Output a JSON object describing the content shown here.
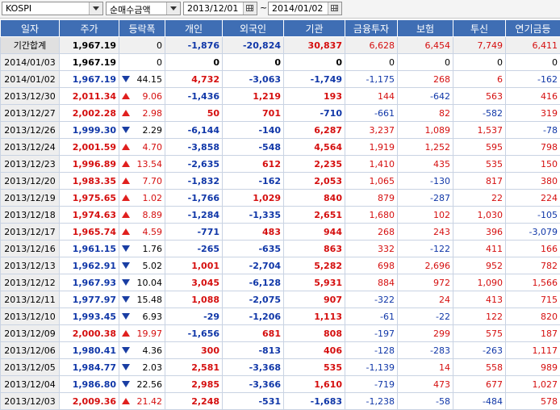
{
  "toolbar": {
    "market": "KOSPI",
    "metric": "순매수금액",
    "date_from": "2013/12/01",
    "date_to": "2014/01/02",
    "separator": "~"
  },
  "columns": [
    "일자",
    "주가",
    "등락폭",
    "개인",
    "외국인",
    "기관",
    "금융투자",
    "보험",
    "투신",
    "연기금등"
  ],
  "rows": [
    {
      "date": "기간합계",
      "close": "1,967.19",
      "dir": "none",
      "chg": "0",
      "indiv": "-1,876",
      "foreign": "-20,824",
      "inst": "30,837",
      "fin": "6,628",
      "ins": "6,454",
      "trust": "7,749",
      "pension": "6,411"
    },
    {
      "date": "2014/01/03",
      "close": "1,967.19",
      "dir": "none",
      "chg": "0",
      "indiv": "0",
      "foreign": "0",
      "inst": "0",
      "fin": "0",
      "ins": "0",
      "trust": "0",
      "pension": "0"
    },
    {
      "date": "2014/01/02",
      "close": "1,967.19",
      "dir": "down",
      "chg": "44.15",
      "indiv": "4,732",
      "foreign": "-3,063",
      "inst": "-1,749",
      "fin": "-1,175",
      "ins": "268",
      "trust": "6",
      "pension": "-162"
    },
    {
      "date": "2013/12/30",
      "close": "2,011.34",
      "dir": "up",
      "chg": "9.06",
      "indiv": "-1,436",
      "foreign": "1,219",
      "inst": "193",
      "fin": "144",
      "ins": "-642",
      "trust": "563",
      "pension": "416"
    },
    {
      "date": "2013/12/27",
      "close": "2,002.28",
      "dir": "up",
      "chg": "2.98",
      "indiv": "50",
      "foreign": "701",
      "inst": "-710",
      "fin": "-661",
      "ins": "82",
      "trust": "-582",
      "pension": "319"
    },
    {
      "date": "2013/12/26",
      "close": "1,999.30",
      "dir": "down",
      "chg": "2.29",
      "indiv": "-6,144",
      "foreign": "-140",
      "inst": "6,287",
      "fin": "3,237",
      "ins": "1,089",
      "trust": "1,537",
      "pension": "-78"
    },
    {
      "date": "2013/12/24",
      "close": "2,001.59",
      "dir": "up",
      "chg": "4.70",
      "indiv": "-3,858",
      "foreign": "-548",
      "inst": "4,564",
      "fin": "1,919",
      "ins": "1,252",
      "trust": "595",
      "pension": "798"
    },
    {
      "date": "2013/12/23",
      "close": "1,996.89",
      "dir": "up",
      "chg": "13.54",
      "indiv": "-2,635",
      "foreign": "612",
      "inst": "2,235",
      "fin": "1,410",
      "ins": "435",
      "trust": "535",
      "pension": "150"
    },
    {
      "date": "2013/12/20",
      "close": "1,983.35",
      "dir": "up",
      "chg": "7.70",
      "indiv": "-1,832",
      "foreign": "-162",
      "inst": "2,053",
      "fin": "1,065",
      "ins": "-130",
      "trust": "817",
      "pension": "380"
    },
    {
      "date": "2013/12/19",
      "close": "1,975.65",
      "dir": "up",
      "chg": "1.02",
      "indiv": "-1,766",
      "foreign": "1,029",
      "inst": "840",
      "fin": "879",
      "ins": "-287",
      "trust": "22",
      "pension": "224"
    },
    {
      "date": "2013/12/18",
      "close": "1,974.63",
      "dir": "up",
      "chg": "8.89",
      "indiv": "-1,284",
      "foreign": "-1,335",
      "inst": "2,651",
      "fin": "1,680",
      "ins": "102",
      "trust": "1,030",
      "pension": "-105"
    },
    {
      "date": "2013/12/17",
      "close": "1,965.74",
      "dir": "up",
      "chg": "4.59",
      "indiv": "-771",
      "foreign": "483",
      "inst": "944",
      "fin": "268",
      "ins": "243",
      "trust": "396",
      "pension": "-3,079"
    },
    {
      "date": "2013/12/16",
      "close": "1,961.15",
      "dir": "down",
      "chg": "1.76",
      "indiv": "-265",
      "foreign": "-635",
      "inst": "863",
      "fin": "332",
      "ins": "-122",
      "trust": "411",
      "pension": "166"
    },
    {
      "date": "2013/12/13",
      "close": "1,962.91",
      "dir": "down",
      "chg": "5.02",
      "indiv": "1,001",
      "foreign": "-2,704",
      "inst": "5,282",
      "fin": "698",
      "ins": "2,696",
      "trust": "952",
      "pension": "782"
    },
    {
      "date": "2013/12/12",
      "close": "1,967.93",
      "dir": "down",
      "chg": "10.04",
      "indiv": "3,045",
      "foreign": "-6,128",
      "inst": "5,931",
      "fin": "884",
      "ins": "972",
      "trust": "1,090",
      "pension": "1,566"
    },
    {
      "date": "2013/12/11",
      "close": "1,977.97",
      "dir": "down",
      "chg": "15.48",
      "indiv": "1,088",
      "foreign": "-2,075",
      "inst": "907",
      "fin": "-322",
      "ins": "24",
      "trust": "413",
      "pension": "715"
    },
    {
      "date": "2013/12/10",
      "close": "1,993.45",
      "dir": "down",
      "chg": "6.93",
      "indiv": "-29",
      "foreign": "-1,206",
      "inst": "1,113",
      "fin": "-61",
      "ins": "-22",
      "trust": "122",
      "pension": "820"
    },
    {
      "date": "2013/12/09",
      "close": "2,000.38",
      "dir": "up",
      "chg": "19.97",
      "indiv": "-1,656",
      "foreign": "681",
      "inst": "808",
      "fin": "-197",
      "ins": "299",
      "trust": "575",
      "pension": "187"
    },
    {
      "date": "2013/12/06",
      "close": "1,980.41",
      "dir": "down",
      "chg": "4.36",
      "indiv": "300",
      "foreign": "-813",
      "inst": "406",
      "fin": "-128",
      "ins": "-283",
      "trust": "-263",
      "pension": "1,117"
    },
    {
      "date": "2013/12/05",
      "close": "1,984.77",
      "dir": "down",
      "chg": "2.03",
      "indiv": "2,581",
      "foreign": "-3,368",
      "inst": "535",
      "fin": "-1,139",
      "ins": "14",
      "trust": "558",
      "pension": "989"
    },
    {
      "date": "2013/12/04",
      "close": "1,986.80",
      "dir": "down",
      "chg": "22.56",
      "indiv": "2,985",
      "foreign": "-3,366",
      "inst": "1,610",
      "fin": "-719",
      "ins": "473",
      "trust": "677",
      "pension": "1,027"
    },
    {
      "date": "2013/12/03",
      "close": "2,009.36",
      "dir": "up",
      "chg": "21.42",
      "indiv": "2,248",
      "foreign": "-531",
      "inst": "-1,683",
      "fin": "-1,238",
      "ins": "-58",
      "trust": "-484",
      "pension": "578"
    }
  ],
  "colors": {
    "up": "#d50f0f",
    "down": "#1037a8",
    "header_bg": "#3f6eb4"
  }
}
